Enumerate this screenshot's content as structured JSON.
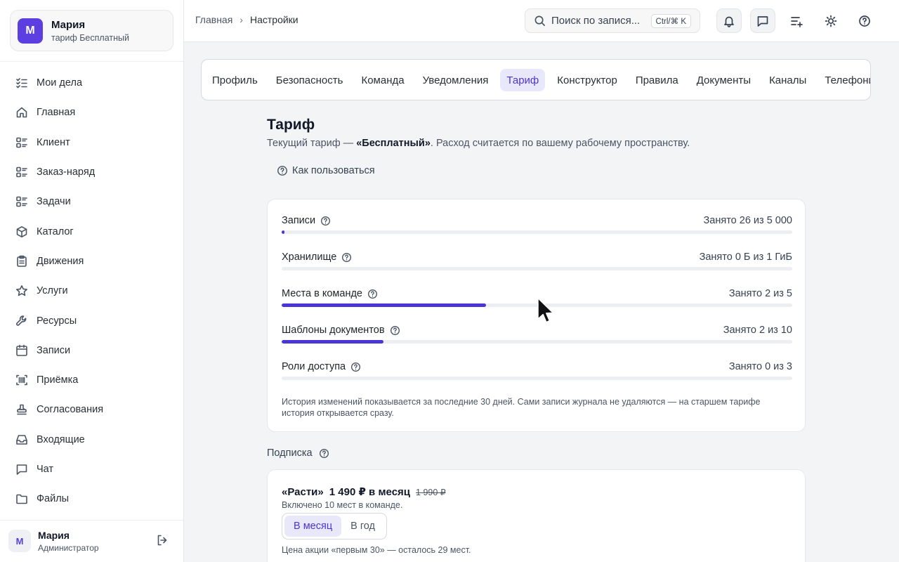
{
  "workspace": {
    "initial": "М",
    "name": "Мария",
    "plan": "тариф Бесплатный"
  },
  "sidebar": {
    "items": [
      {
        "label": "Мои дела",
        "icon": "checklist-icon"
      },
      {
        "label": "Главная",
        "icon": "home-icon"
      },
      {
        "label": "Клиент",
        "icon": "list-grid-icon"
      },
      {
        "label": "Заказ-наряд",
        "icon": "list-grid-icon"
      },
      {
        "label": "Задачи",
        "icon": "list-grid-icon"
      },
      {
        "label": "Каталог",
        "icon": "box-icon"
      },
      {
        "label": "Движения",
        "icon": "clipboard-icon"
      },
      {
        "label": "Услуги",
        "icon": "star-icon"
      },
      {
        "label": "Ресурсы",
        "icon": "wrench-icon"
      },
      {
        "label": "Записи",
        "icon": "calendar-icon"
      },
      {
        "label": "Приёмка",
        "icon": "scan-icon"
      },
      {
        "label": "Согласования",
        "icon": "stamp-icon"
      },
      {
        "label": "Входящие",
        "icon": "inbox-icon"
      },
      {
        "label": "Чат",
        "icon": "chat-icon"
      },
      {
        "label": "Файлы",
        "icon": "folder-icon"
      }
    ]
  },
  "user": {
    "initial": "М",
    "name": "Мария",
    "role": "Администратор"
  },
  "breadcrumb": {
    "home": "Главная",
    "current": "Настройки"
  },
  "search": {
    "placeholder": "Поиск по запися...",
    "shortcut": "Ctrl/⌘ K"
  },
  "tabs": [
    {
      "label": "Профиль",
      "active": false
    },
    {
      "label": "Безопасность",
      "active": false
    },
    {
      "label": "Команда",
      "active": false
    },
    {
      "label": "Уведомления",
      "active": false
    },
    {
      "label": "Тариф",
      "active": true
    },
    {
      "label": "Конструктор",
      "active": false
    },
    {
      "label": "Правила",
      "active": false
    },
    {
      "label": "Документы",
      "active": false
    },
    {
      "label": "Каналы",
      "active": false
    },
    {
      "label": "Телефония",
      "active": false
    }
  ],
  "page": {
    "title": "Тариф",
    "subtitle_prefix": "Текущий тариф — ",
    "subtitle_plan": "«Бесплатный»",
    "subtitle_suffix": ". Расход считается по вашему рабочему пространству.",
    "howto": "Как пользоваться"
  },
  "usage": {
    "items": [
      {
        "label": "Записи",
        "value": "Занято 26 из 5 000",
        "fraction": 0.0052
      },
      {
        "label": "Хранилище",
        "value": "Занято 0 Б из 1 ГиБ",
        "fraction": 0
      },
      {
        "label": "Места в команде",
        "value": "Занято 2 из 5",
        "fraction": 0.4
      },
      {
        "label": "Шаблоны документов",
        "value": "Занято 2 из 10",
        "fraction": 0.2
      },
      {
        "label": "Роли доступа",
        "value": "Занято 0 из 3",
        "fraction": 0
      }
    ],
    "note": "История изменений показывается за последние 30 дней. Сами записи журнала не удаляются — на старшем тарифе история открывается сразу."
  },
  "subscription": {
    "heading": "Подписка",
    "plan_name": "«Расти»",
    "price": "1 490 ₽ в месяц",
    "old_price": "1 990 ₽",
    "included": "Включено 10 мест в команде.",
    "period_month": "В месяц",
    "period_year": "В год",
    "promo": "Цена акции «первым 30» — осталось 29 мест."
  },
  "colors": {
    "accent": "#4a35d8",
    "accent_bg": "#e9e8fb",
    "avatar": "#5b3fe0"
  }
}
